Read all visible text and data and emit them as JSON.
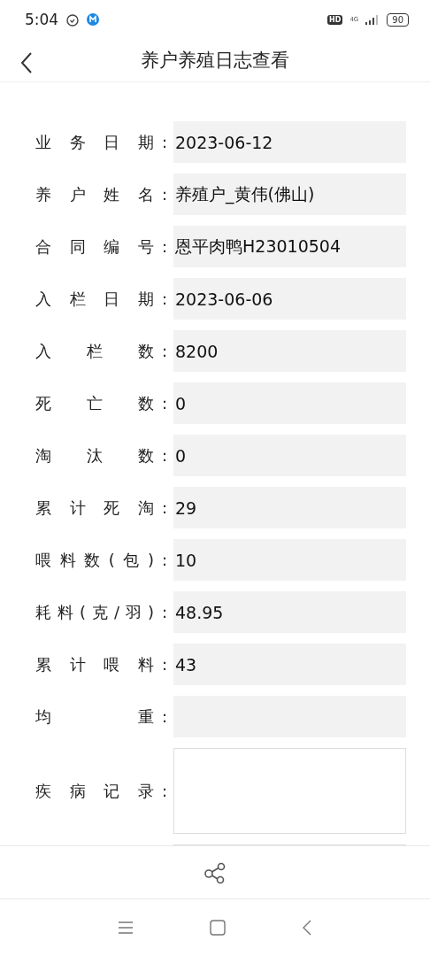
{
  "status_bar": {
    "time": "5:04",
    "hd": "HD",
    "network": "4G",
    "battery": "90"
  },
  "header": {
    "title": "养户养殖日志查看"
  },
  "form": [
    {
      "kind": "text",
      "label": "业务日期",
      "value": "2023-06-12"
    },
    {
      "kind": "text",
      "label": "养户姓名",
      "value": "养殖户_黄伟(佛山)"
    },
    {
      "kind": "text",
      "label": "合同编号",
      "value": "恩平肉鸭H23010504"
    },
    {
      "kind": "text",
      "label": "入栏日期",
      "value": "2023-06-06"
    },
    {
      "kind": "text",
      "label": "入栏数",
      "value": "8200"
    },
    {
      "kind": "text",
      "label": "死亡数",
      "value": "0"
    },
    {
      "kind": "text",
      "label": "淘汰数",
      "value": "0"
    },
    {
      "kind": "text",
      "label": "累计死淘",
      "value": "29"
    },
    {
      "kind": "text",
      "label": "喂料数(包)",
      "value": "10"
    },
    {
      "kind": "text",
      "label": "耗料(克/羽)",
      "value": "48.95"
    },
    {
      "kind": "text",
      "label": "累计喂料",
      "value": "43"
    },
    {
      "kind": "text",
      "label": "均重"
    },
    {
      "kind": "textarea",
      "label": "疾病记录"
    },
    {
      "kind": "textarea"
    }
  ],
  "colon": ":"
}
